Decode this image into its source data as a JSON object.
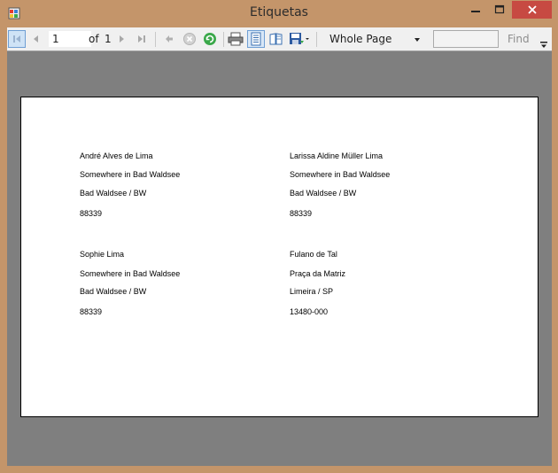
{
  "window": {
    "title": "Etiquetas",
    "close_color": "#c74a42",
    "frame_color": "#c4956a"
  },
  "toolbar": {
    "current_page": "1",
    "of_label": "of",
    "total_pages": "1",
    "zoom_value": "Whole Page",
    "find_value": "",
    "find_label": "Find",
    "icons": [
      "first-page-icon",
      "previous-page-icon",
      "next-page-icon",
      "last-page-icon",
      "back-icon",
      "stop-icon",
      "refresh-icon",
      "print-icon",
      "print-layout-icon",
      "page-setup-icon",
      "export-icon"
    ]
  },
  "labels": [
    {
      "name": "André Alves de Lima",
      "street": "Somewhere in Bad Waldsee",
      "city": "Bad Waldsee / BW",
      "zip": "88339"
    },
    {
      "name": "Larissa Aldine Müller Lima",
      "street": "Somewhere in Bad Waldsee",
      "city": "Bad Waldsee / BW",
      "zip": "88339"
    },
    {
      "name": "Sophie Lima",
      "street": "Somewhere in Bad Waldsee",
      "city": "Bad Waldsee / BW",
      "zip": "88339"
    },
    {
      "name": "Fulano de Tal",
      "street": "Praça da Matriz",
      "city": "Limeira / SP",
      "zip": "13480-000"
    }
  ]
}
